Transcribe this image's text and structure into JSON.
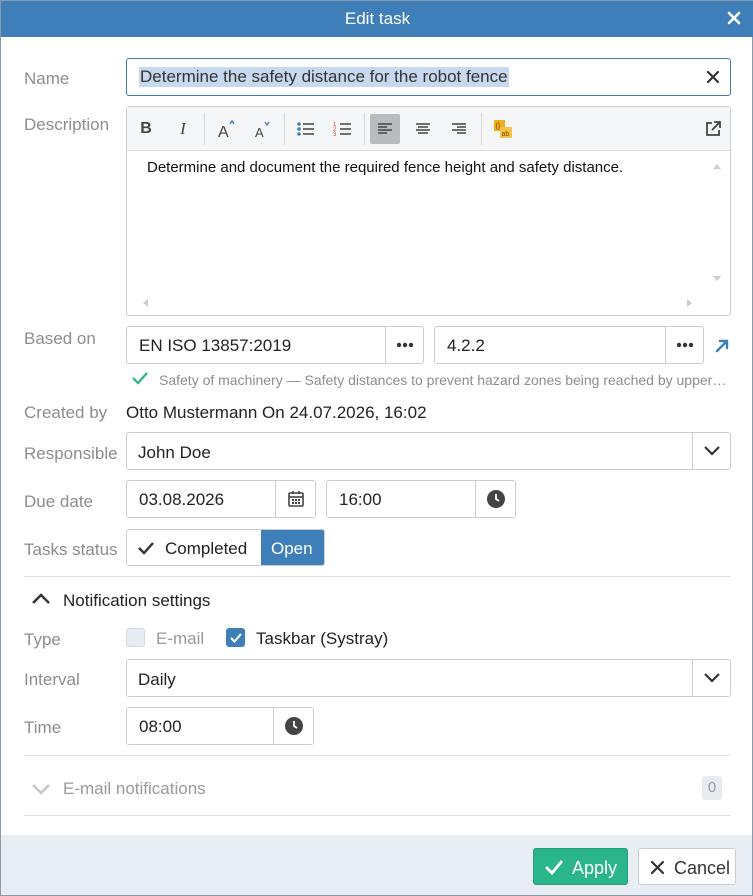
{
  "dialog": {
    "title": "Edit task"
  },
  "form": {
    "name_label": "Name",
    "name_value": "Determine the safety distance for the robot fence",
    "description_label": "Description",
    "description_text": "Determine and document the required fence height and safety distance.",
    "based_on_label": "Based on",
    "standard_value": "EN ISO 13857:2019",
    "section_value": "4.2.2",
    "standard_info": "Safety of machinery — Safety distances to prevent hazard zones being reached by upper and lower limbs",
    "created_by_label": "Created by",
    "created_by_value": "Otto Mustermann On 24.07.2026, 16:02",
    "responsible_label": "Responsible",
    "responsible_value": "John Doe",
    "due_date_label": "Due date",
    "due_date_value": "03.08.2026",
    "due_time_value": "16:00",
    "status_label": "Tasks status",
    "status_completed": "Completed",
    "status_open": "Open",
    "status_selected": "Open"
  },
  "notification": {
    "section_title": "Notification settings",
    "type_label": "Type",
    "email_option": "E-mail",
    "email_checked": false,
    "taskbar_option": "Taskbar (Systray)",
    "taskbar_checked": true,
    "interval_label": "Interval",
    "interval_value": "Daily",
    "time_label": "Time",
    "time_value": "08:00"
  },
  "email_notifications": {
    "title": "E-mail notifications",
    "count": "0"
  },
  "footer": {
    "apply_label": "Apply",
    "cancel_label": "Cancel"
  },
  "colors": {
    "primary": "#3f7fb9",
    "success": "#2bb58b",
    "check": "#2bb58b",
    "label": "#8d8d8d"
  }
}
